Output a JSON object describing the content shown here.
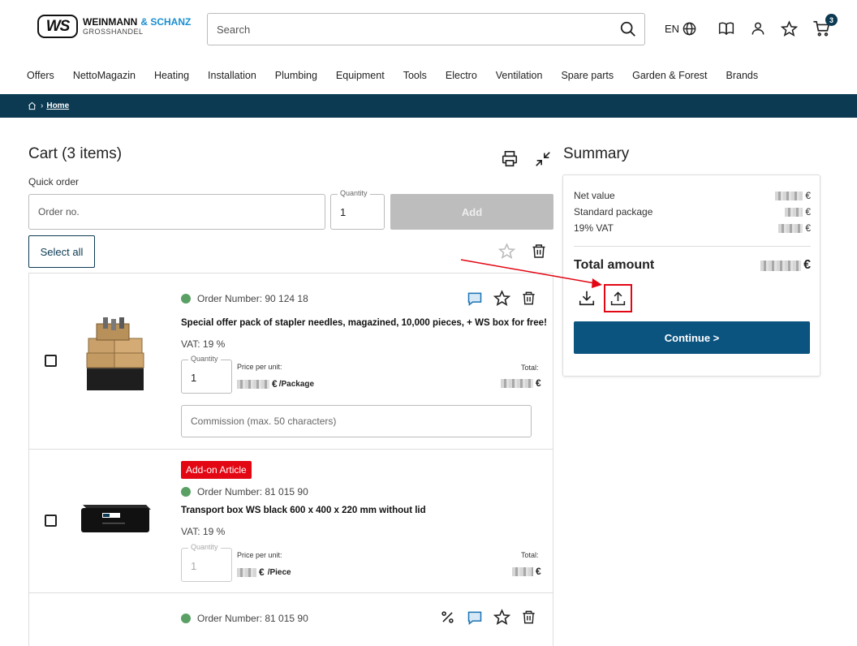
{
  "header": {
    "logo_mark": "WS",
    "logo_name": "WEINMANN",
    "logo_amp": "& SCHANZ",
    "logo_sub": "GROSSHANDEL",
    "search_placeholder": "Search",
    "lang": "EN",
    "cart_count": "3"
  },
  "nav": [
    "Offers",
    "NettoMagazin",
    "Heating",
    "Installation",
    "Plumbing",
    "Equipment",
    "Tools",
    "Electro",
    "Ventilation",
    "Spare parts",
    "Garden & Forest",
    "Brands"
  ],
  "breadcrumb": {
    "home": "Home"
  },
  "cart": {
    "title": "Cart (3 items)",
    "quick_order_label": "Quick order",
    "order_no_placeholder": "Order no.",
    "quantity_label": "Quantity",
    "quantity_value": "1",
    "add_label": "Add",
    "select_all": "Select all",
    "items": [
      {
        "order_number": "Order Number: 90 124 18",
        "name": "Special offer pack of stapler needles, magazined, 10,000 pieces, + WS box for free!",
        "vat": "VAT: 19 %",
        "quantity_label": "Quantity",
        "quantity": "1",
        "ppu_label": "Price per unit:",
        "ppu_currency": "€",
        "ppu_unit": "/Package",
        "total_label": "Total:",
        "total_currency": "€",
        "comment_placeholder": "Commission (max. 50 characters)"
      },
      {
        "badge": "Add-on Article",
        "order_number": "Order Number: 81 015 90",
        "name": "Transport box WS black 600 x 400 x 220 mm without lid",
        "vat": "VAT: 19 %",
        "quantity_label": "Quantity",
        "quantity": "1",
        "ppu_label": "Price per unit:",
        "ppu_currency": "€",
        "ppu_unit": "/Piece",
        "total_label": "Total:",
        "total_currency": "€"
      },
      {
        "order_number": "Order Number: 81 015 90"
      }
    ]
  },
  "summary": {
    "title": "Summary",
    "net_value_label": "Net value",
    "standard_package_label": "Standard package",
    "vat_label": "19% VAT",
    "currency": "€",
    "total_label": "Total amount",
    "continue_label": "Continue >"
  },
  "colors": {
    "brand_dark": "#0b3a52",
    "button_blue": "#0b5480",
    "accent_red": "#e30613",
    "status_green": "#5aa064"
  }
}
